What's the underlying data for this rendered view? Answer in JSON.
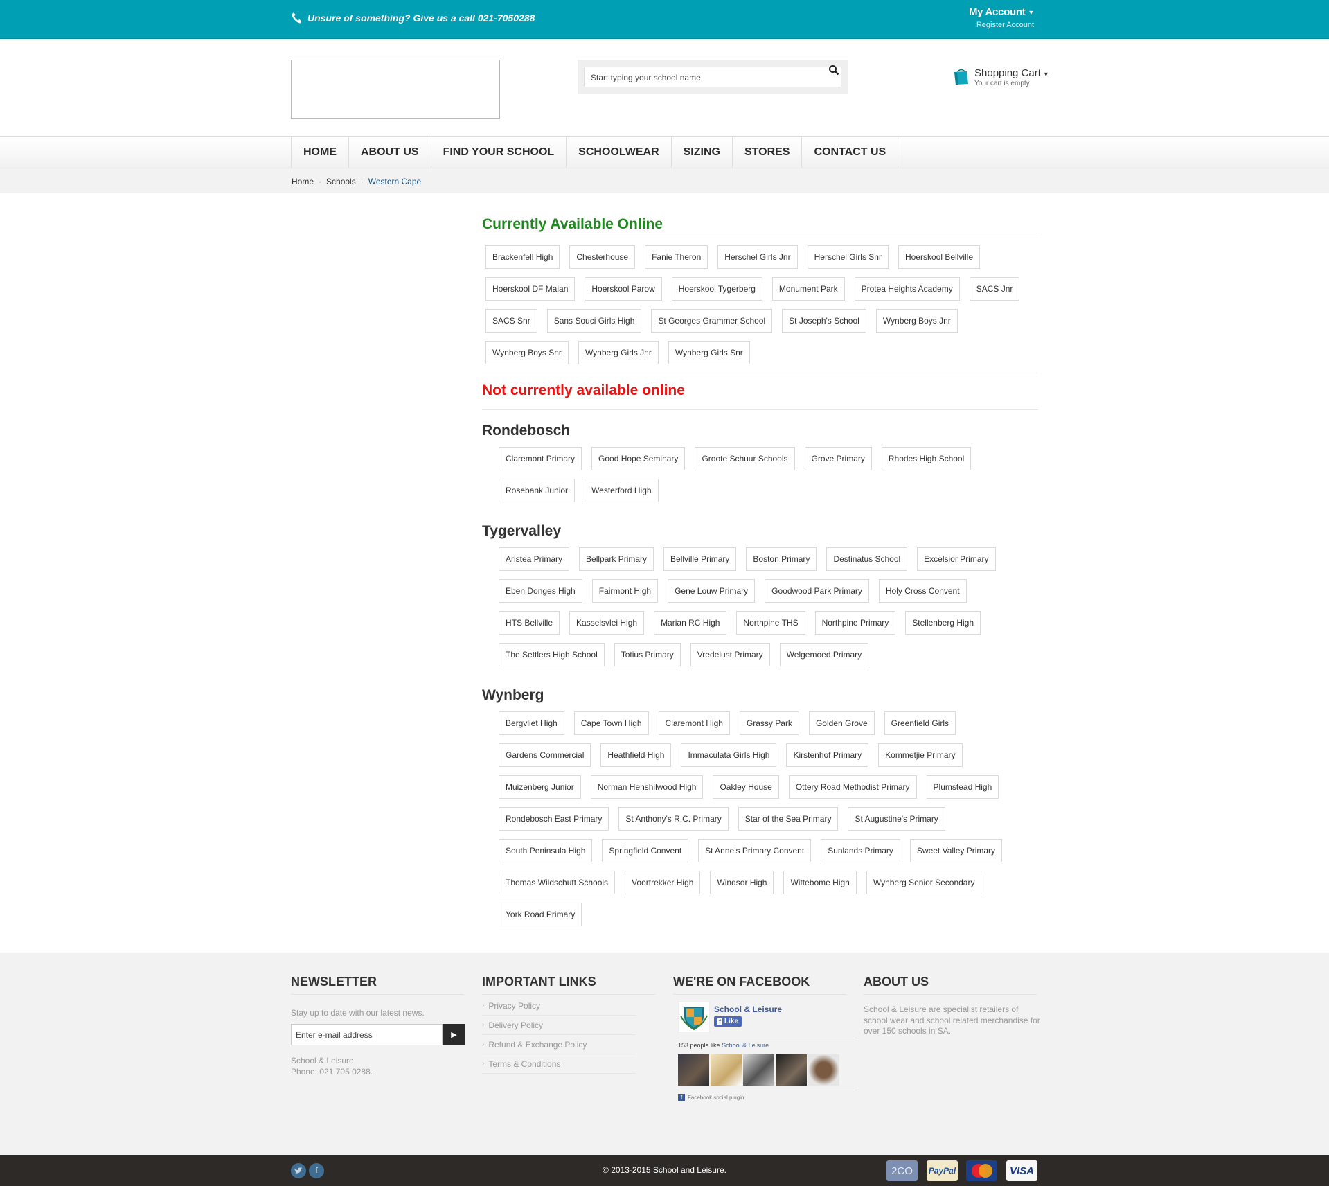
{
  "topbar": {
    "phone_text": "Unsure of something?  Give us a call 021-7050288",
    "account_label": "My Account",
    "register_label": "Register Account"
  },
  "header": {
    "search_placeholder": "Start typing your school name",
    "cart_title": "Shopping Cart",
    "cart_status": "Your cart is empty"
  },
  "nav": [
    "Home",
    "About Us",
    "Find Your School",
    "Schoolwear",
    "Sizing",
    "Stores",
    "Contact Us"
  ],
  "breadcrumb": [
    "Home",
    "Schools",
    "Western Cape"
  ],
  "available": {
    "heading": "Currently Available Online",
    "schools": [
      "Brackenfell High",
      "Chesterhouse",
      "Fanie Theron",
      "Herschel Girls Jnr",
      "Herschel Girls Snr",
      "Hoerskool Bellville",
      "Hoerskool DF Malan",
      "Hoerskool Parow",
      "Hoerskool Tygerberg",
      "Monument Park",
      "Protea Heights Academy",
      "SACS Jnr",
      "SACS Snr",
      "Sans Souci Girls High",
      "St Georges Grammer School",
      "St Joseph's School",
      "Wynberg Boys Jnr",
      "Wynberg Boys Snr",
      "Wynberg Girls Jnr",
      "Wynberg Girls Snr"
    ]
  },
  "unavailable": {
    "heading": "Not currently available online",
    "regions": [
      {
        "name": "Rondebosch",
        "schools": [
          "Claremont Primary",
          "Good Hope Seminary",
          "Groote Schuur Schools",
          "Grove Primary",
          "Rhodes High School",
          "Rosebank Junior",
          "Westerford High"
        ]
      },
      {
        "name": "Tygervalley",
        "schools": [
          "Aristea Primary",
          "Bellpark Primary",
          "Bellville Primary",
          "Boston Primary",
          "Destinatus School",
          "Excelsior Primary",
          "Eben Donges High",
          "Fairmont High",
          "Gene Louw Primary",
          "Goodwood Park Primary",
          "Holy Cross Convent",
          "HTS Bellville",
          "Kasselsvlei High",
          "Marian RC High",
          "Northpine THS",
          "Northpine Primary",
          "Stellenberg High",
          "The Settlers High School",
          "Totius Primary",
          "Vredelust Primary",
          "Welgemoed Primary"
        ]
      },
      {
        "name": "Wynberg",
        "schools": [
          "Bergvliet High",
          "Cape Town High",
          "Claremont High",
          "Grassy Park",
          "Golden Grove",
          "Greenfield Girls",
          "Gardens Commercial",
          "Heathfield High",
          "Immaculata Girls High",
          "Kirstenhof Primary",
          "Kommetjie Primary",
          "Muizenberg Junior",
          "Norman Henshilwood High",
          "Oakley House",
          "Ottery Road Methodist Primary",
          "Plumstead High",
          "Rondebosch East Primary",
          "St Anthony's R.C. Primary",
          "Star of the Sea Primary",
          "St Augustine's Primary",
          "South Peninsula High",
          "Springfield Convent",
          "St Anne's Primary Convent",
          "Sunlands Primary",
          "Sweet Valley Primary",
          "Thomas Wildschutt Schools",
          "Voortrekker High",
          "Windsor High",
          "Wittebome High",
          "Wynberg Senior Secondary",
          "York Road Primary"
        ]
      }
    ]
  },
  "footer": {
    "newsletter": {
      "title": "Newsletter",
      "text": "Stay up to date with our latest news.",
      "email_placeholder": "Enter e-mail address",
      "company": "School & Leisure",
      "phone": "Phone: 021 705 0288."
    },
    "links": {
      "title": "Important Links",
      "items": [
        "Privacy Policy",
        "Delivery Policy",
        "Refund & Exchange Policy",
        "Terms & Conditions"
      ]
    },
    "facebook": {
      "title": "We're on Facebook",
      "page_name": "School & Leisure",
      "like_label": "Like",
      "likes_prefix": "153 people like ",
      "likes_page": "School & Leisure",
      "likes_suffix": ".",
      "plugin_label": "Facebook social plugin"
    },
    "about": {
      "title": "About Us",
      "text": "School & Leisure are specialist retailers of school wear and school related merchandise for over 150 schools in SA."
    }
  },
  "bottom": {
    "copyright": "© 2013-2015 School and Leisure.",
    "payments": [
      "2CO",
      "PayPal",
      "MasterCard",
      "VISA"
    ]
  },
  "colors": {
    "topbar": "#009fb4",
    "available": "#1e8a1e",
    "unavailable": "#ee1111",
    "bottombar": "#2d2a28"
  }
}
